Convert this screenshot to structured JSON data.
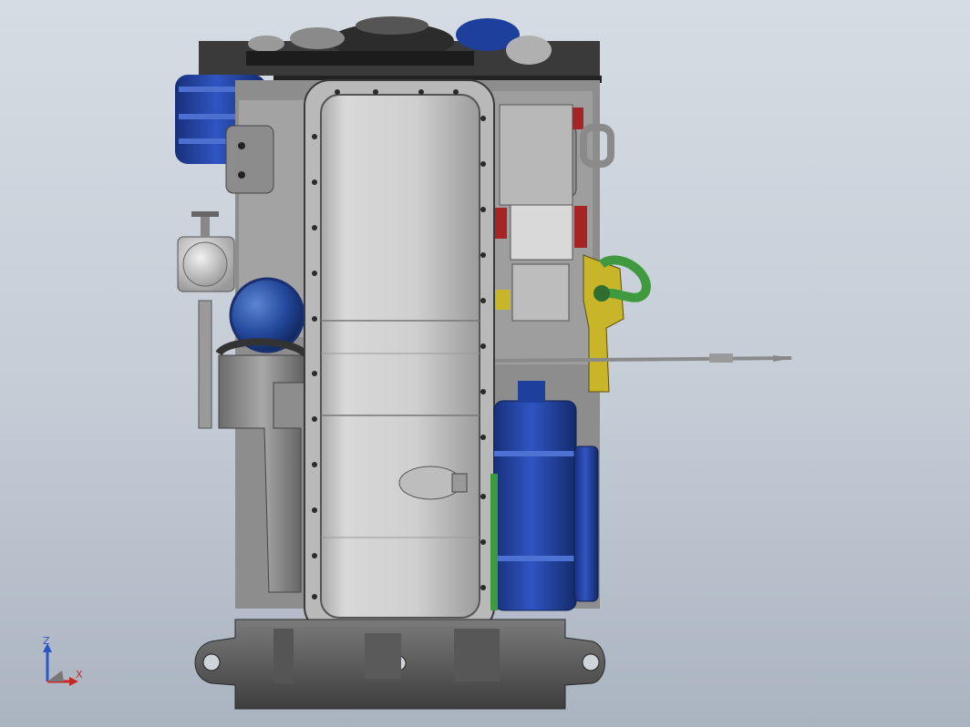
{
  "view": {
    "axes": {
      "vertical": {
        "label": "Z",
        "color": "#2f56c9"
      },
      "horizontal": {
        "label": "X",
        "color": "#c62828"
      }
    }
  },
  "colors": {
    "background_top": "#d6dce3",
    "background_bottom": "#aab4c0",
    "oil_pan": "#c9c9c9",
    "block_dark": "#6a6a6a",
    "accent_blue": "#1f3f9c",
    "accent_yellow": "#c9b52a",
    "accent_green": "#3f9a3f",
    "accent_red": "#a72424"
  },
  "icons": {
    "triad": "coordinate-triad-icon"
  }
}
